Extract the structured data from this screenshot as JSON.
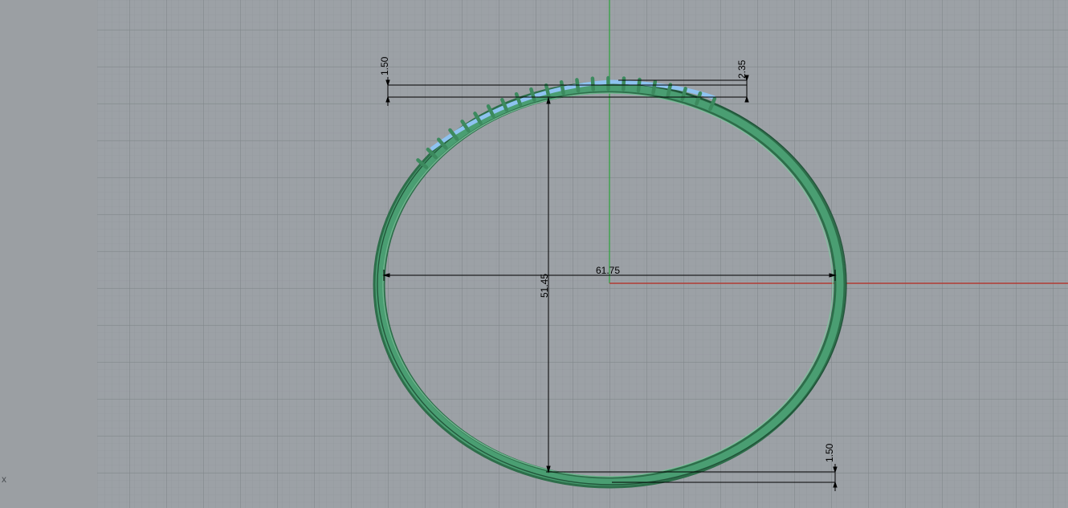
{
  "viewport": {
    "axis_indicator": "x",
    "colors": {
      "background": "#9a9fa4",
      "grid_minor": "#8f9499",
      "grid_major": "#7b8085",
      "x_axis": "#b23a34",
      "y_axis": "#2aa23a",
      "ring": "#3f8d62",
      "highlight": "#8ec3f0",
      "dimension": "#000000"
    }
  },
  "dimensions": {
    "top_left_offset": "1.50",
    "top_right_offset": "2.35",
    "width": "61.75",
    "height": "51.45",
    "bottom_right_offset": "1.50"
  }
}
